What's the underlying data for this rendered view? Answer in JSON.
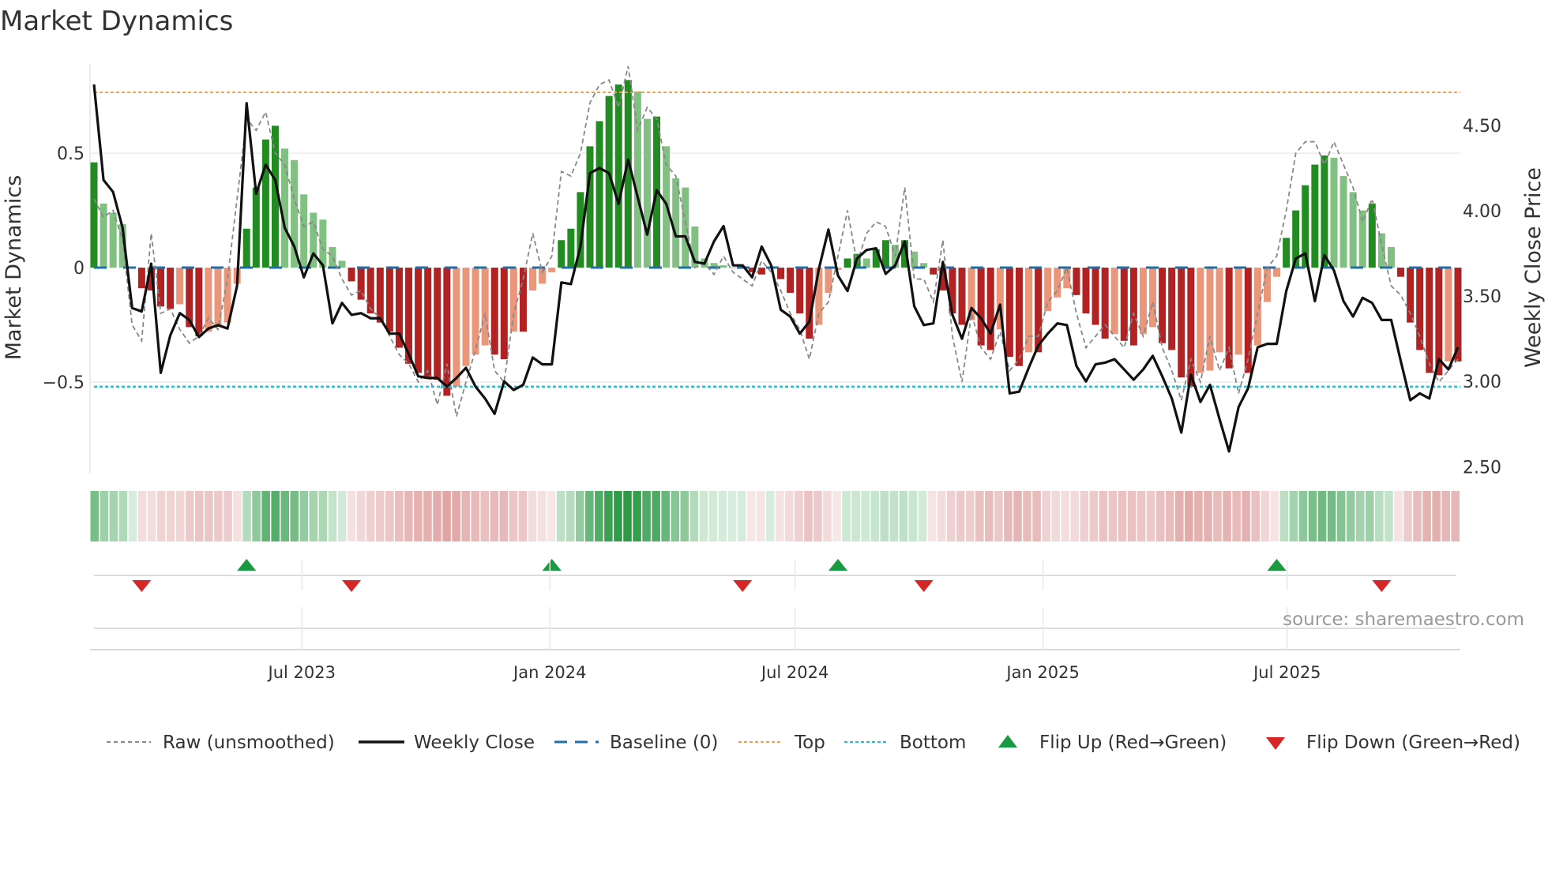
{
  "chart_data": {
    "type": "bar",
    "title": "Market Dynamics",
    "ylabel_left": "Market Dynamics",
    "ylabel_right": "Weekly Close Price",
    "ylim_left": [
      -0.9,
      0.89
    ],
    "ylim_right": [
      2.46,
      4.86
    ],
    "yticks_left": [
      {
        "v": 0.5,
        "label": "0.5"
      },
      {
        "v": 0,
        "label": "0"
      },
      {
        "v": -0.5,
        "label": "−0.5"
      }
    ],
    "yticks_right": [
      {
        "v": 4.5,
        "label": "4.50"
      },
      {
        "v": 4.0,
        "label": "4.00"
      },
      {
        "v": 3.5,
        "label": "3.50"
      },
      {
        "v": 3.0,
        "label": "3.00"
      },
      {
        "v": 2.5,
        "label": "2.50"
      }
    ],
    "xticks": [
      {
        "week": 21.8,
        "label": "Jul 2023"
      },
      {
        "week": 47.8,
        "label": "Jan 2024"
      },
      {
        "week": 73.5,
        "label": "Jul 2024"
      },
      {
        "week": 99.5,
        "label": "Jan 2025"
      },
      {
        "week": 125.1,
        "label": "Jul 2025"
      }
    ],
    "top_level": 0.766,
    "bottom_level": -0.52,
    "baseline": 0,
    "dynamics": [
      0.46,
      0.28,
      0.24,
      0.19,
      0.0,
      -0.09,
      -0.1,
      -0.17,
      -0.18,
      -0.16,
      -0.26,
      -0.3,
      -0.28,
      -0.26,
      -0.24,
      -0.07,
      0.17,
      0.35,
      0.56,
      0.62,
      0.52,
      0.47,
      0.32,
      0.24,
      0.21,
      0.09,
      0.03,
      -0.06,
      -0.14,
      -0.2,
      -0.24,
      -0.28,
      -0.35,
      -0.42,
      -0.46,
      -0.48,
      -0.49,
      -0.56,
      -0.52,
      -0.43,
      -0.38,
      -0.34,
      -0.38,
      -0.4,
      -0.28,
      -0.28,
      -0.1,
      -0.07,
      -0.02,
      0.12,
      0.17,
      0.33,
      0.53,
      0.64,
      0.75,
      0.8,
      0.82,
      0.77,
      0.65,
      0.66,
      0.53,
      0.39,
      0.35,
      0.18,
      0.04,
      0.02,
      0.01,
      0.0,
      0.005,
      -0.02,
      -0.03,
      0.0,
      -0.05,
      -0.11,
      -0.2,
      -0.31,
      -0.25,
      -0.11,
      -0.01,
      0.04,
      0.06,
      0.04,
      0.08,
      0.12,
      0.1,
      0.12,
      0.07,
      0.02,
      -0.03,
      -0.1,
      -0.2,
      -0.25,
      -0.23,
      -0.34,
      -0.36,
      -0.27,
      -0.39,
      -0.43,
      -0.37,
      -0.37,
      -0.19,
      -0.13,
      -0.09,
      -0.12,
      -0.2,
      -0.25,
      -0.31,
      -0.29,
      -0.32,
      -0.34,
      -0.29,
      -0.26,
      -0.33,
      -0.36,
      -0.48,
      -0.52,
      -0.46,
      -0.45,
      -0.37,
      -0.44,
      -0.38,
      -0.46,
      -0.34,
      -0.15,
      -0.04,
      0.13,
      0.25,
      0.36,
      0.45,
      0.49,
      0.48,
      0.4,
      0.33,
      0.25,
      0.28,
      0.15,
      0.09,
      -0.04,
      -0.24,
      -0.36,
      -0.46,
      -0.47,
      -0.41,
      -0.41
    ],
    "raw": [
      0.3,
      0.22,
      0.25,
      0.12,
      -0.25,
      -0.32,
      0.15,
      -0.2,
      -0.18,
      -0.27,
      -0.33,
      -0.3,
      -0.22,
      -0.27,
      -0.05,
      0.3,
      0.65,
      0.6,
      0.68,
      0.5,
      0.45,
      0.3,
      0.18,
      0.2,
      0.08,
      0.05,
      -0.05,
      -0.12,
      -0.1,
      -0.18,
      -0.22,
      -0.3,
      -0.38,
      -0.42,
      -0.5,
      -0.45,
      -0.6,
      -0.42,
      -0.65,
      -0.5,
      -0.36,
      -0.2,
      -0.45,
      -0.5,
      -0.2,
      -0.05,
      0.15,
      -0.02,
      0.05,
      0.42,
      0.4,
      0.5,
      0.72,
      0.8,
      0.82,
      0.7,
      0.88,
      0.6,
      0.7,
      0.65,
      0.45,
      0.4,
      0.2,
      0.0,
      0.02,
      -0.03,
      0.05,
      -0.02,
      -0.05,
      -0.08,
      0.03,
      -0.02,
      -0.1,
      -0.2,
      -0.27,
      -0.4,
      -0.2,
      -0.15,
      0.05,
      0.25,
      0.02,
      0.15,
      0.2,
      0.18,
      0.05,
      0.35,
      -0.05,
      -0.05,
      -0.15,
      0.12,
      -0.3,
      -0.5,
      -0.2,
      -0.35,
      -0.4,
      -0.28,
      -0.45,
      -0.4,
      -0.3,
      -0.3,
      -0.15,
      -0.1,
      0.0,
      -0.2,
      -0.35,
      -0.3,
      -0.25,
      -0.3,
      -0.35,
      -0.2,
      -0.3,
      -0.15,
      -0.35,
      -0.45,
      -0.58,
      -0.4,
      -0.5,
      -0.3,
      -0.45,
      -0.35,
      -0.55,
      -0.4,
      -0.2,
      0.0,
      0.05,
      0.25,
      0.5,
      0.55,
      0.55,
      0.45,
      0.55,
      0.45,
      0.35,
      0.2,
      0.3,
      0.1,
      -0.08,
      -0.12,
      -0.2,
      -0.3,
      -0.42,
      -0.5,
      -0.45,
      -0.4
    ],
    "weekly_close": [
      4.74,
      4.18,
      4.11,
      3.9,
      3.43,
      3.41,
      3.69,
      3.05,
      3.27,
      3.4,
      3.36,
      3.26,
      3.31,
      3.33,
      3.31,
      3.56,
      4.63,
      4.1,
      4.27,
      4.18,
      3.9,
      3.79,
      3.61,
      3.75,
      3.68,
      3.34,
      3.46,
      3.39,
      3.4,
      3.37,
      3.37,
      3.28,
      3.28,
      3.16,
      3.03,
      3.02,
      3.02,
      2.97,
      3.02,
      3.08,
      2.97,
      2.9,
      2.81,
      3.0,
      2.95,
      2.98,
      3.14,
      3.1,
      3.1,
      3.58,
      3.57,
      3.79,
      4.22,
      4.25,
      4.22,
      4.04,
      4.3,
      4.08,
      3.86,
      4.12,
      4.04,
      3.85,
      3.85,
      3.7,
      3.69,
      3.82,
      3.91,
      3.68,
      3.68,
      3.61,
      3.79,
      3.68,
      3.42,
      3.38,
      3.28,
      3.35,
      3.66,
      3.89,
      3.62,
      3.53,
      3.72,
      3.77,
      3.78,
      3.63,
      3.68,
      3.82,
      3.44,
      3.33,
      3.34,
      3.7,
      3.39,
      3.25,
      3.43,
      3.37,
      3.28,
      3.45,
      2.93,
      2.94,
      3.08,
      3.21,
      3.28,
      3.34,
      3.33,
      3.09,
      3.0,
      3.1,
      3.11,
      3.13,
      3.07,
      3.01,
      3.07,
      3.15,
      3.03,
      2.9,
      2.7,
      3.04,
      2.88,
      2.98,
      2.78,
      2.59,
      2.85,
      2.96,
      3.2,
      3.22,
      3.22,
      3.53,
      3.72,
      3.75,
      3.47,
      3.74,
      3.65,
      3.47,
      3.38,
      3.49,
      3.46,
      3.36,
      3.36,
      3.12,
      2.89,
      2.93,
      2.9,
      3.13,
      3.07,
      3.2
    ],
    "flip_up_weeks": [
      16,
      48,
      78,
      124
    ],
    "flip_down_weeks": [
      5,
      27,
      68,
      87,
      135
    ],
    "colors": {
      "up_strong": "#228b22",
      "up_weak": "#80c080",
      "down_strong": "#b22222",
      "down_weak": "#e9967a",
      "close": "#111111",
      "raw": "#888888",
      "baseline": "#1f6fa8",
      "top": "#f0a050",
      "bottom": "#20c0d0",
      "flip_up": "#1a9a40",
      "flip_down": "#d62728"
    },
    "legend": {
      "raw": "Raw (unsmoothed)",
      "close": "Weekly Close",
      "baseline": "Baseline (0)",
      "top": "Top",
      "bottom": "Bottom",
      "flip_up": "Flip Up (Red→Green)",
      "flip_down": "Flip Down (Green→Red)"
    },
    "source": "source: sharemaestro.com"
  }
}
